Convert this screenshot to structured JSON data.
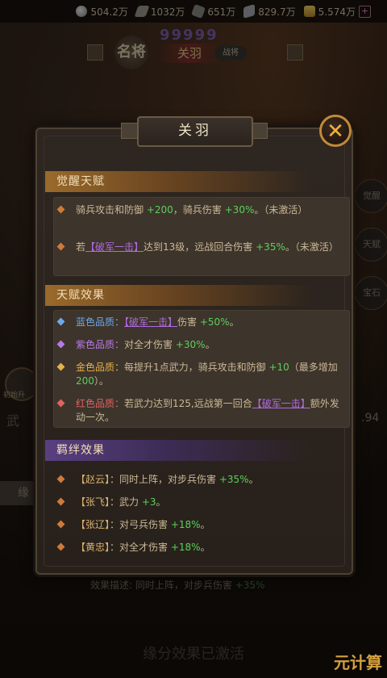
{
  "resources": [
    {
      "icon": "coin-icon",
      "value": "504.2万"
    },
    {
      "icon": "food-icon",
      "value": "1032万"
    },
    {
      "icon": "wood-icon",
      "value": "651万"
    },
    {
      "icon": "iron-icon",
      "value": "829.7万"
    },
    {
      "icon": "gold-icon",
      "value": "5.574万"
    }
  ],
  "hero_header": {
    "stars": "99999",
    "badge": "名将",
    "name": "关羽",
    "tag": "战将"
  },
  "background": {
    "left_label": "初始升",
    "left_big": "武",
    "left_tab": "缘",
    "right_labels": [
      "觉醒",
      "天赋",
      "宝石"
    ],
    "right_num": ".94",
    "bottom_desc_label": "效果描述:",
    "bottom_desc_text": "同时上阵，对步兵伤害",
    "bottom_desc_value": "+35%",
    "bottom_status": "缘分效果已激活",
    "watermark": "元计算"
  },
  "popup": {
    "title": "关羽",
    "close_symbol": "✕",
    "sections": [
      {
        "title": "觉醒天赋",
        "items": [
          {
            "parts": [
              [
                "t",
                "骑兵攻击和防御 "
              ],
              [
                "g",
                "+200"
              ],
              [
                "t",
                "，骑兵伤害 "
              ],
              [
                "g",
                "+30%"
              ],
              [
                "t",
                "。（未激活）"
              ]
            ]
          },
          {
            "parts": [
              [
                "t",
                "若"
              ],
              [
                "lk",
                "【破军一击】"
              ],
              [
                "t",
                "达到13级，远战回合伤害 "
              ],
              [
                "g",
                "+35%"
              ],
              [
                "t",
                "。（未激活）"
              ]
            ]
          }
        ]
      },
      {
        "title": "天赋效果",
        "items": [
          {
            "parts": [
              [
                "blue",
                "蓝色品质："
              ],
              [
                "lk",
                "【破军一击】"
              ],
              [
                "t",
                "伤害 "
              ],
              [
                "g",
                "+50%"
              ],
              [
                "t",
                "。"
              ]
            ]
          },
          {
            "parts": [
              [
                "purple",
                "紫色品质："
              ],
              [
                "t",
                "对全才伤害 "
              ],
              [
                "g",
                "+30%"
              ],
              [
                "t",
                "。"
              ]
            ]
          },
          {
            "parts": [
              [
                "gold",
                "金色品质："
              ],
              [
                "t",
                "每提升1点武力，骑兵攻击和防御 "
              ],
              [
                "g",
                "+10"
              ],
              [
                "t",
                "（最多增加 "
              ],
              [
                "g",
                "200"
              ],
              [
                "t",
                "）。"
              ]
            ]
          },
          {
            "parts": [
              [
                "red",
                "红色品质："
              ],
              [
                "t",
                "若武力达到125,远战第一回合"
              ],
              [
                "lk",
                "【破军一击】"
              ],
              [
                "t",
                "额外发动一次。"
              ]
            ]
          }
        ]
      },
      {
        "title": "羁绊效果",
        "items": [
          {
            "parts": [
              [
                "bond",
                "【赵云】"
              ],
              [
                "t",
                "：同时上阵，对步兵伤害 "
              ],
              [
                "g",
                "+35%"
              ],
              [
                "t",
                "。"
              ]
            ]
          },
          {
            "parts": [
              [
                "bond",
                "【张飞】"
              ],
              [
                "t",
                "：武力 "
              ],
              [
                "g",
                "+3"
              ],
              [
                "t",
                "。"
              ]
            ]
          },
          {
            "parts": [
              [
                "bond",
                "【张辽】"
              ],
              [
                "t",
                "：对弓兵伤害 "
              ],
              [
                "g",
                "+18%"
              ],
              [
                "t",
                "。"
              ]
            ]
          },
          {
            "parts": [
              [
                "bond",
                "【黄忠】"
              ],
              [
                "t",
                "：对全才伤害 "
              ],
              [
                "g",
                "+18%"
              ],
              [
                "t",
                "。"
              ]
            ]
          }
        ]
      }
    ]
  },
  "colors": {
    "accent_green": "#5bd05b",
    "link_purple": "#b06ae0",
    "blue_quality": "#6fa8e8",
    "purple_quality": "#b97ae6",
    "gold_quality": "#e6b14a",
    "red_quality": "#e26262"
  }
}
